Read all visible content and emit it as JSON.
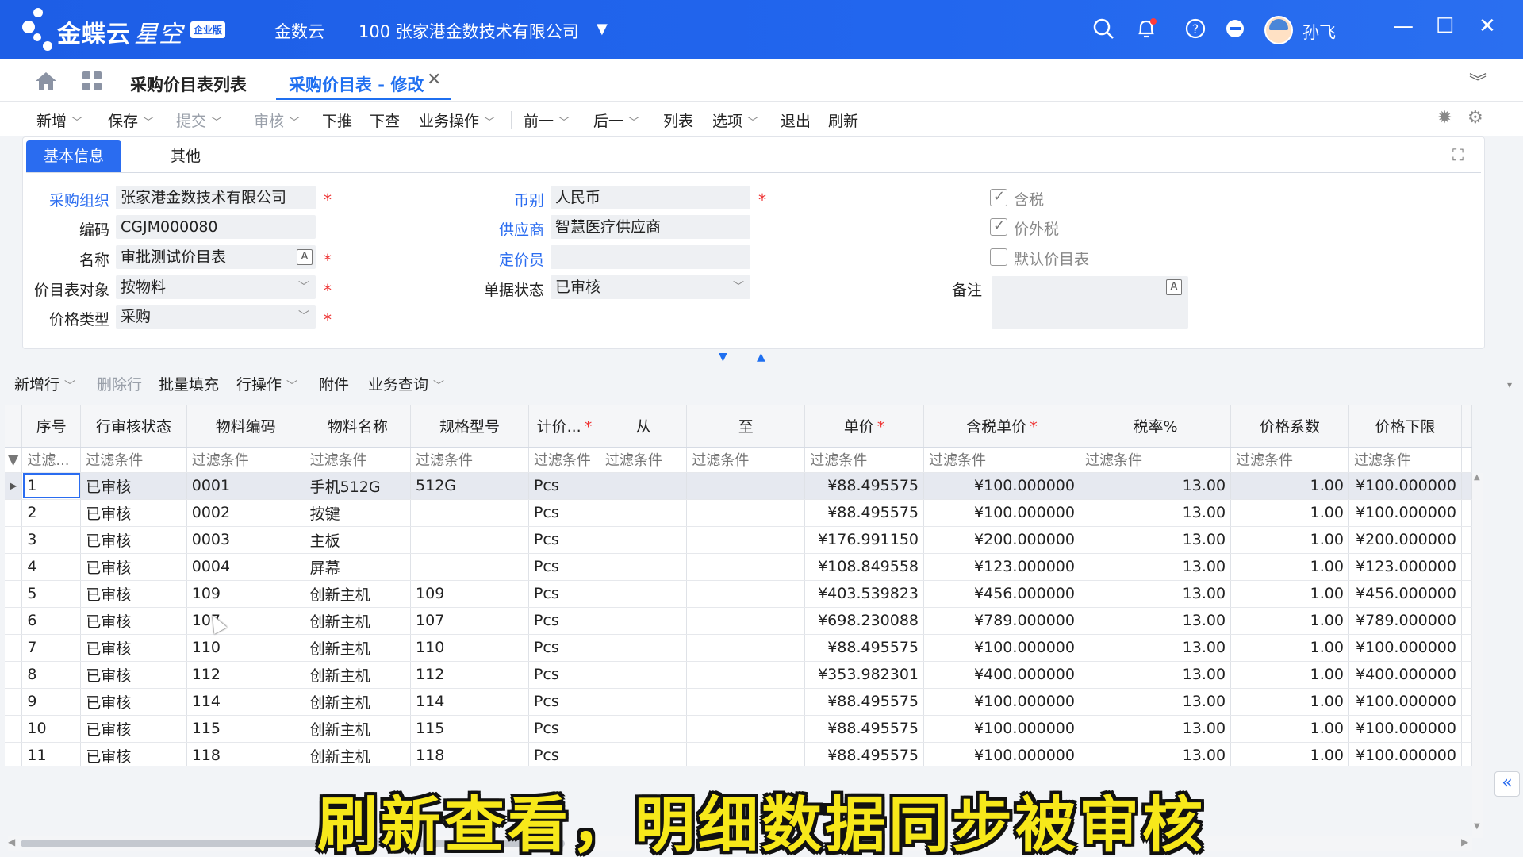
{
  "topbar": {
    "brand": "金蝶云",
    "brand_sub": "星空",
    "edition": "企业版",
    "product": "金数云",
    "company": "100  张家港金数技术有限公司",
    "user": "孙飞"
  },
  "tabs": {
    "list_tab": "采购价目表列表",
    "active_tab": "采购价目表 - 修改"
  },
  "toolbar": {
    "add": "新增",
    "save": "保存",
    "submit": "提交",
    "audit": "审核",
    "push_down": "下推",
    "lookup_down": "下查",
    "business_ops": "业务操作",
    "prev": "前一",
    "next": "后一",
    "list": "列表",
    "options": "选项",
    "exit": "退出",
    "refresh": "刷新"
  },
  "form": {
    "tab_basic": "基本信息",
    "tab_other": "其他",
    "purchase_org_label": "采购组织",
    "purchase_org": "张家港金数技术有限公司",
    "code_label": "编码",
    "code": "CGJM000080",
    "name_label": "名称",
    "name": "审批测试价目表",
    "target_label": "价目表对象",
    "target": "按物料",
    "price_type_label": "价格类型",
    "price_type": "采购",
    "currency_label": "币别",
    "currency": "人民币",
    "supplier_label": "供应商",
    "supplier": "智慧医疗供应商",
    "pricer_label": "定价员",
    "pricer": "",
    "doc_status_label": "单据状态",
    "doc_status": "已审核",
    "tax_incl_label": "含税",
    "tax_incl": true,
    "tax_excl_label": "价外税",
    "tax_excl": true,
    "default_label": "默认价目表",
    "default": false,
    "remark_label": "备注",
    "remark": "",
    "text_btn": "A"
  },
  "grid_toolbar": {
    "add_row": "新增行",
    "delete_row": "删除行",
    "batch_fill": "批量填充",
    "row_ops": "行操作",
    "attachment": "附件",
    "biz_query": "业务查询"
  },
  "grid": {
    "columns": [
      "序号",
      "行审核状态",
      "物料编码",
      "物料名称",
      "规格型号",
      "计价...",
      "从",
      "至",
      "单价",
      "含税单价",
      "税率%",
      "价格系数",
      "价格下限"
    ],
    "filter_first": "过滤...",
    "filter": "过滤条件",
    "rows": [
      [
        "1",
        "已审核",
        "0001",
        "手机512G",
        "512G",
        "Pcs",
        "",
        "",
        "¥88.495575",
        "¥100.000000",
        "13.00",
        "1.00",
        "¥100.000000"
      ],
      [
        "2",
        "已审核",
        "0002",
        "按键",
        "",
        "Pcs",
        "",
        "",
        "¥88.495575",
        "¥100.000000",
        "13.00",
        "1.00",
        "¥100.000000"
      ],
      [
        "3",
        "已审核",
        "0003",
        "主板",
        "",
        "Pcs",
        "",
        "",
        "¥176.991150",
        "¥200.000000",
        "13.00",
        "1.00",
        "¥200.000000"
      ],
      [
        "4",
        "已审核",
        "0004",
        "屏幕",
        "",
        "Pcs",
        "",
        "",
        "¥108.849558",
        "¥123.000000",
        "13.00",
        "1.00",
        "¥123.000000"
      ],
      [
        "5",
        "已审核",
        "109",
        "创新主机",
        "109",
        "Pcs",
        "",
        "",
        "¥403.539823",
        "¥456.000000",
        "13.00",
        "1.00",
        "¥456.000000"
      ],
      [
        "6",
        "已审核",
        "107",
        "创新主机",
        "107",
        "Pcs",
        "",
        "",
        "¥698.230088",
        "¥789.000000",
        "13.00",
        "1.00",
        "¥789.000000"
      ],
      [
        "7",
        "已审核",
        "110",
        "创新主机",
        "110",
        "Pcs",
        "",
        "",
        "¥88.495575",
        "¥100.000000",
        "13.00",
        "1.00",
        "¥100.000000"
      ],
      [
        "8",
        "已审核",
        "112",
        "创新主机",
        "112",
        "Pcs",
        "",
        "",
        "¥353.982301",
        "¥400.000000",
        "13.00",
        "1.00",
        "¥400.000000"
      ],
      [
        "9",
        "已审核",
        "114",
        "创新主机",
        "114",
        "Pcs",
        "",
        "",
        "¥88.495575",
        "¥100.000000",
        "13.00",
        "1.00",
        "¥100.000000"
      ],
      [
        "10",
        "已审核",
        "115",
        "创新主机",
        "115",
        "Pcs",
        "",
        "",
        "¥88.495575",
        "¥100.000000",
        "13.00",
        "1.00",
        "¥100.000000"
      ],
      [
        "11",
        "已审核",
        "118",
        "创新主机",
        "118",
        "Pcs",
        "",
        "",
        "¥88.495575",
        "¥100.000000",
        "13.00",
        "1.00",
        "¥100.000000"
      ]
    ]
  },
  "subtitle": "刷新查看，明细数据同步被审核"
}
